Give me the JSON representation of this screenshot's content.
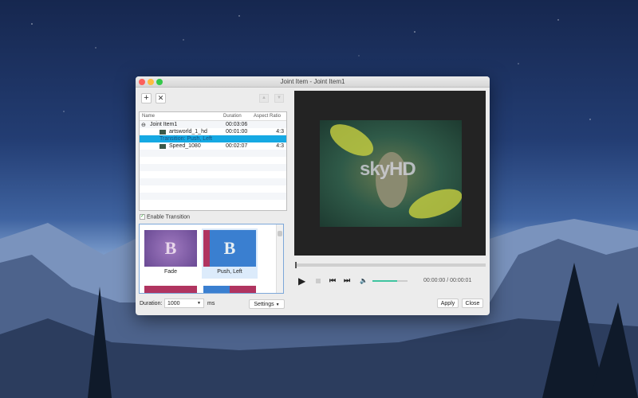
{
  "window": {
    "title": "Joint Item - Joint Item1"
  },
  "toolbar": {
    "add_icon": "plus-icon",
    "remove_icon": "x-icon",
    "up_icon": "up-icon",
    "down_icon": "down-icon"
  },
  "tree": {
    "headers": [
      "Name",
      "Duration",
      "Aspect Ratio"
    ],
    "rows": [
      {
        "name": "Joint Item1",
        "duration": "00:03:06",
        "aspect": ""
      },
      {
        "name": "artsworld_1_hd",
        "duration": "00:01:00",
        "aspect": "4:3"
      },
      {
        "name": "Transition: Push, Left",
        "duration": "",
        "aspect": ""
      },
      {
        "name": "Speed_1080",
        "duration": "00:02:07",
        "aspect": "4:3"
      }
    ]
  },
  "transition": {
    "enable_label": "Enable Transition",
    "enabled": true,
    "items": [
      {
        "label": "Fade"
      },
      {
        "label": "Push, Left",
        "selected": true
      }
    ],
    "duration_label": "Duration:",
    "duration_value": "1000",
    "unit": "ms",
    "settings_label": "Settings"
  },
  "player": {
    "watermark": "skyHD",
    "time": "00:00:00 / 00:00:01",
    "volume": 0.7,
    "progress": 0
  },
  "buttons": {
    "apply": "Apply",
    "close": "Close"
  }
}
